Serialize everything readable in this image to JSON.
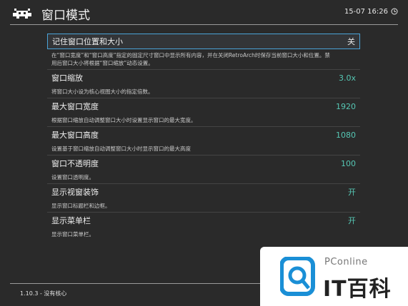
{
  "header": {
    "title": "窗口模式",
    "clock": "15-07 16:26"
  },
  "items": [
    {
      "label": "记住窗口位置和大小",
      "value": "关",
      "desc": [
        "在“窗口宽度”和“窗口高度”指定的固定尺寸窗口中显示所有内容，并在关闭RetroArch时保存当前窗口大小和位置。禁",
        "用后窗口大小将根据“窗口缩放”动态设置。"
      ],
      "selected": true
    },
    {
      "label": "窗口缩放",
      "value": "3.0x",
      "desc": [
        "将窗口大小设为核心视图大小的指定倍数。"
      ]
    },
    {
      "label": "最大窗口宽度",
      "value": "1920",
      "desc": [
        "根据窗口缩放自动调整窗口大小时设置显示窗口的最大宽度。"
      ]
    },
    {
      "label": "最大窗口高度",
      "value": "1080",
      "desc": [
        "设置基于窗口缩放自动调整窗口大小时显示窗口的最大高度"
      ]
    },
    {
      "label": "窗口不透明度",
      "value": "100",
      "desc": [
        "设置窗口透明度。"
      ]
    },
    {
      "label": "显示视窗装饰",
      "value": "开",
      "desc": [
        "显示窗口标题栏和边框。"
      ]
    },
    {
      "label": "显示菜单栏",
      "value": "开",
      "desc": [
        "显示窗口菜单栏。"
      ]
    }
  ],
  "footer": {
    "status": "1.10.3 - 没有核心"
  },
  "watermark": {
    "brand": "PConline",
    "name": "IT百科"
  },
  "colors": {
    "accent": "#56c7b4",
    "selection": "#4aa3d8",
    "background": "#2a2a2a"
  }
}
